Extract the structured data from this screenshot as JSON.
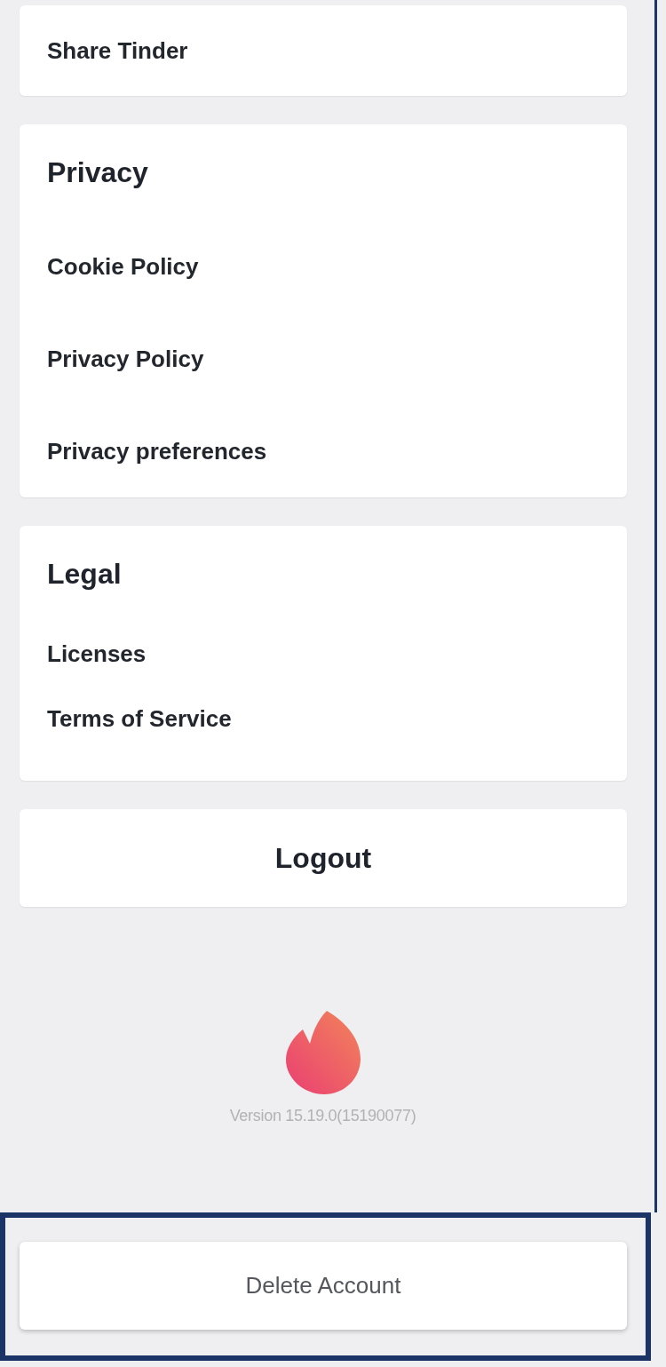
{
  "sections": [
    {
      "kind": "plain",
      "items": [
        {
          "label": "Share Tinder"
        }
      ]
    },
    {
      "kind": "titled",
      "title": "Privacy",
      "items": [
        {
          "label": "Cookie Policy"
        },
        {
          "label": "Privacy Policy"
        },
        {
          "label": "Privacy preferences"
        }
      ]
    },
    {
      "kind": "titled",
      "title": "Legal",
      "items": [
        {
          "label": "Licenses"
        },
        {
          "label": "Terms of Service"
        }
      ]
    }
  ],
  "logout_button": {
    "label": "Logout"
  },
  "version": "Version 15.19.0(15190077)",
  "delete_account_button": {
    "label": "Delete Account",
    "highlighted": true
  }
}
